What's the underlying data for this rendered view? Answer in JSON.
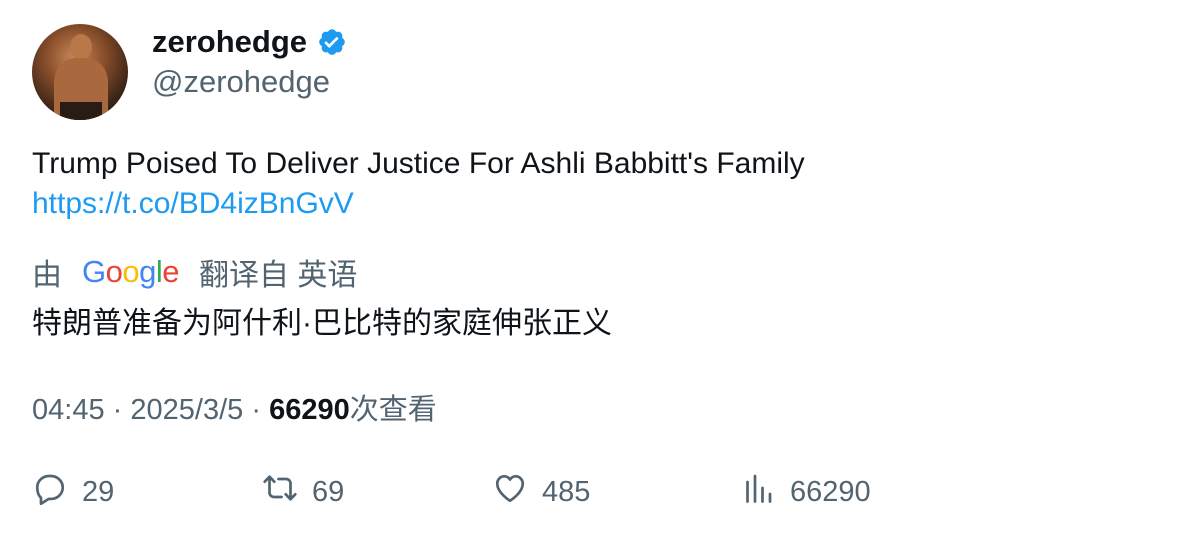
{
  "author": {
    "display_name": "zerohedge",
    "handle": "@zerohedge",
    "verified_icon": "verified-badge-icon",
    "badge_color": "#1d9bf0"
  },
  "tweet": {
    "text": "Trump Poised To Deliver Justice For Ashli Babbitt's Family",
    "link": "https://t.co/BD4izBnGvV"
  },
  "translation": {
    "prefix": "由",
    "provider": "Google",
    "suffix": "翻译自 英语",
    "text": "特朗普准备为阿什利·巴比特的家庭伸张正义"
  },
  "meta": {
    "time": "04:45",
    "separator": "·",
    "date": "2025/3/5",
    "views": "66290",
    "views_label": "次查看"
  },
  "actions": {
    "replies": "29",
    "retweets": "69",
    "likes": "485",
    "views": "66290"
  },
  "colors": {
    "text_primary": "#0f1419",
    "text_secondary": "#536471",
    "link": "#1d9bf0"
  }
}
